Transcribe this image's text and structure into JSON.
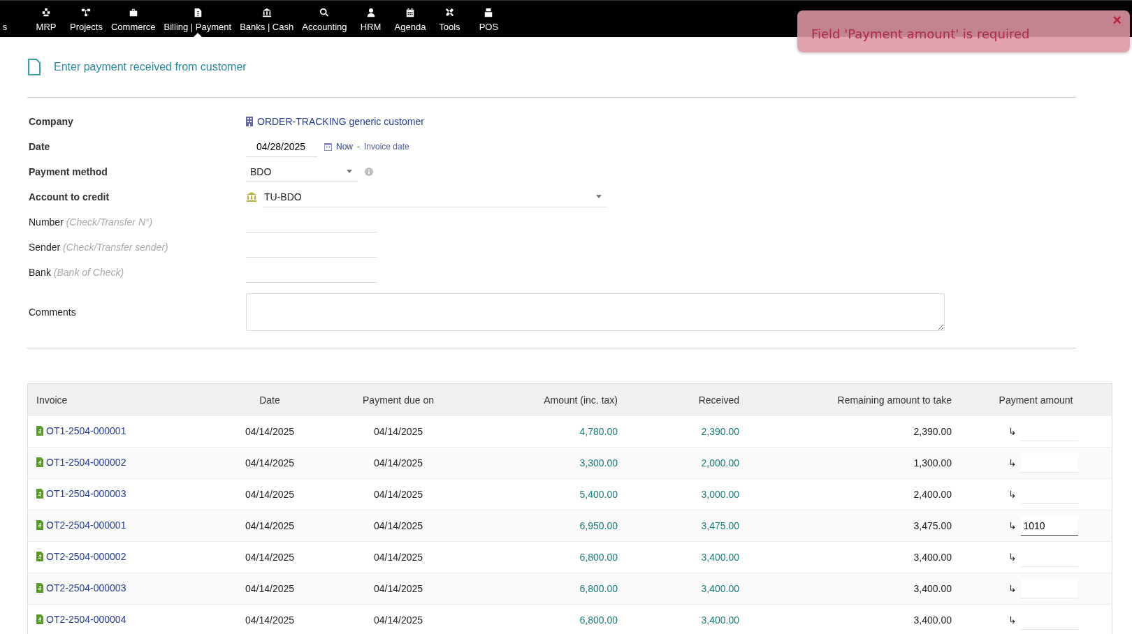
{
  "nav": {
    "items": [
      {
        "label": "s",
        "selected": false
      },
      {
        "label": "MRP",
        "selected": false
      },
      {
        "label": "Projects",
        "selected": false
      },
      {
        "label": "Commerce",
        "selected": false
      },
      {
        "label": "Billing | Payment",
        "selected": true
      },
      {
        "label": "Banks | Cash",
        "selected": false
      },
      {
        "label": "Accounting",
        "selected": false
      },
      {
        "label": "HRM",
        "selected": false
      },
      {
        "label": "Agenda",
        "selected": false
      },
      {
        "label": "Tools",
        "selected": false
      },
      {
        "label": "POS",
        "selected": false
      }
    ]
  },
  "toast": {
    "message": "Field 'Payment amount' is required",
    "close": "×"
  },
  "page": {
    "title": "Enter payment received from customer"
  },
  "form": {
    "company": {
      "label": "Company",
      "value": "ORDER-TRACKING generic customer"
    },
    "date": {
      "label": "Date",
      "value": "04/28/2025",
      "now": "Now",
      "separator": "-",
      "invoice_date": "Invoice date"
    },
    "payment_method": {
      "label": "Payment method",
      "value": "BDO"
    },
    "account": {
      "label": "Account to credit",
      "value": "TU-BDO"
    },
    "number": {
      "label": "Number",
      "hint": "(Check/Transfer N°)"
    },
    "sender": {
      "label": "Sender",
      "hint": "(Check/Transfer sender)"
    },
    "bank": {
      "label": "Bank",
      "hint": "(Bank of Check)"
    },
    "comments": {
      "label": "Comments"
    }
  },
  "table": {
    "columns": [
      "Invoice",
      "Date",
      "Payment due on",
      "Amount (inc. tax)",
      "Received",
      "Remaining amount to take",
      "Payment amount"
    ],
    "rows": [
      {
        "invoice": "OT1-2504-000001",
        "date": "04/14/2025",
        "due": "04/14/2025",
        "amount": "4,780.00",
        "received": "2,390.00",
        "remaining": "2,390.00",
        "arrow": "↳"
      },
      {
        "invoice": "OT1-2504-000002",
        "date": "04/14/2025",
        "due": "04/14/2025",
        "amount": "3,300.00",
        "received": "2,000.00",
        "remaining": "1,300.00",
        "arrow": "↳"
      },
      {
        "invoice": "OT1-2504-000003",
        "date": "04/14/2025",
        "due": "04/14/2025",
        "amount": "5,400.00",
        "received": "3,000.00",
        "remaining": "2,400.00",
        "arrow": "↳"
      },
      {
        "invoice": "OT2-2504-000001",
        "date": "04/14/2025",
        "due": "04/14/2025",
        "amount": "6,950.00",
        "received": "3,475.00",
        "remaining": "3,475.00",
        "arrow": "↳",
        "payment_amount": "1010"
      },
      {
        "invoice": "OT2-2504-000002",
        "date": "04/14/2025",
        "due": "04/14/2025",
        "amount": "6,800.00",
        "received": "3,400.00",
        "remaining": "3,400.00",
        "arrow": "↳"
      },
      {
        "invoice": "OT2-2504-000003",
        "date": "04/14/2025",
        "due": "04/14/2025",
        "amount": "6,800.00",
        "received": "3,400.00",
        "remaining": "3,400.00",
        "arrow": "↳"
      },
      {
        "invoice": "OT2-2504-000004",
        "date": "04/14/2025",
        "due": "04/14/2025",
        "amount": "6,800.00",
        "received": "3,400.00",
        "remaining": "3,400.00",
        "arrow": "↳"
      }
    ]
  }
}
